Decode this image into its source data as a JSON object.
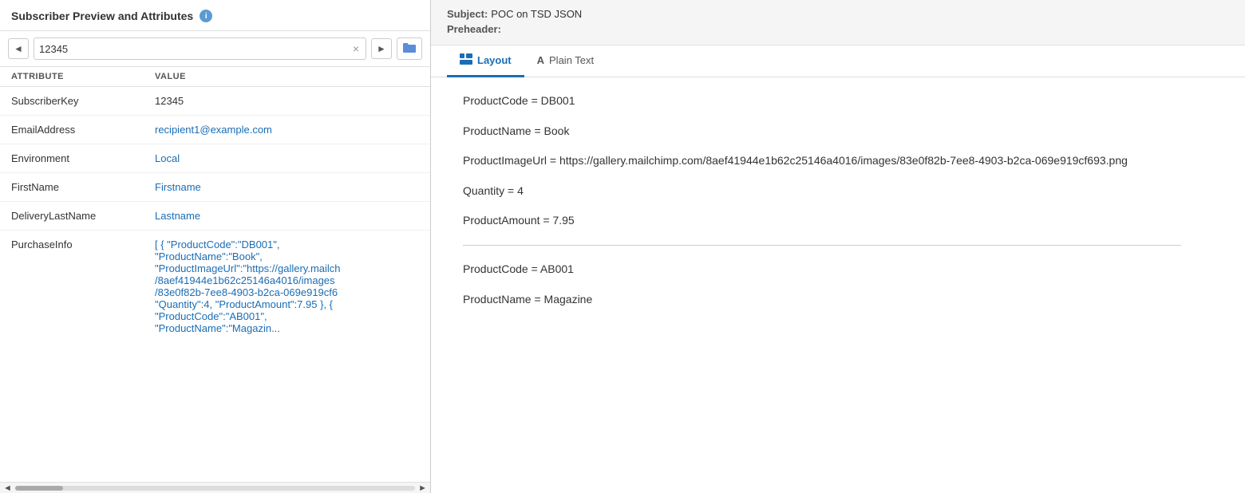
{
  "leftPanel": {
    "title": "Subscriber Preview and Attributes",
    "infoIcon": "i",
    "searchValue": "12345",
    "tableHeaders": {
      "attribute": "ATTRIBUTE",
      "value": "VALUE"
    },
    "rows": [
      {
        "attribute": "SubscriberKey",
        "value": "12345",
        "valueStyle": "dark"
      },
      {
        "attribute": "EmailAddress",
        "value": "recipient1@example.com",
        "valueStyle": "link"
      },
      {
        "attribute": "Environment",
        "value": "Local",
        "valueStyle": "link"
      },
      {
        "attribute": "FirstName",
        "value": "Firstname",
        "valueStyle": "link"
      },
      {
        "attribute": "DeliveryLastName",
        "value": "Lastname",
        "valueStyle": "link"
      },
      {
        "attribute": "PurchaseInfo",
        "value": "[ { \"ProductCode\":\"DB001\", \"ProductName\":\"Book\", \"ProductImageUrl\":\"https://gallery.mailch /8aef41944e1b62c25146a4016/images /83e0f82b-7ee8-4903-b2ca-069e919cf6 \"Quantity\":4, \"ProductAmount\":7.95 }, { \"ProductCode\":\"AB001\", \"ProductName\":\"Magazin...",
        "valueStyle": "link"
      }
    ]
  },
  "rightPanel": {
    "subject": {
      "label": "Subject:",
      "value": "POC on TSD JSON"
    },
    "preheader": {
      "label": "Preheader:",
      "value": ""
    },
    "tabs": [
      {
        "id": "layout",
        "label": "Layout",
        "icon": "layout",
        "active": true
      },
      {
        "id": "plaintext",
        "label": "Plain Text",
        "icon": "text",
        "active": false
      }
    ],
    "previewLines": [
      {
        "id": "line1",
        "text": "ProductCode = DB001"
      },
      {
        "id": "line2",
        "text": "ProductName = Book"
      },
      {
        "id": "line3",
        "text": "ProductImageUrl = https://gallery.mailchimp.com/8aef41944e1b62c25146a4016/images/83e0f82b-7ee8-4903-b2ca-069e919cf693.png"
      },
      {
        "id": "line4",
        "text": "Quantity = 4"
      },
      {
        "id": "line5",
        "text": "ProductAmount = 7.95"
      },
      {
        "id": "divider"
      },
      {
        "id": "line6",
        "text": "ProductCode = AB001"
      },
      {
        "id": "line7",
        "text": "ProductName = Magazine"
      }
    ]
  },
  "icons": {
    "prevArrow": "◄",
    "nextArrow": "►",
    "clear": "×",
    "folder": "📁",
    "scrollLeft": "◄",
    "scrollRight": "►",
    "layout": "⊞",
    "text": "A"
  }
}
